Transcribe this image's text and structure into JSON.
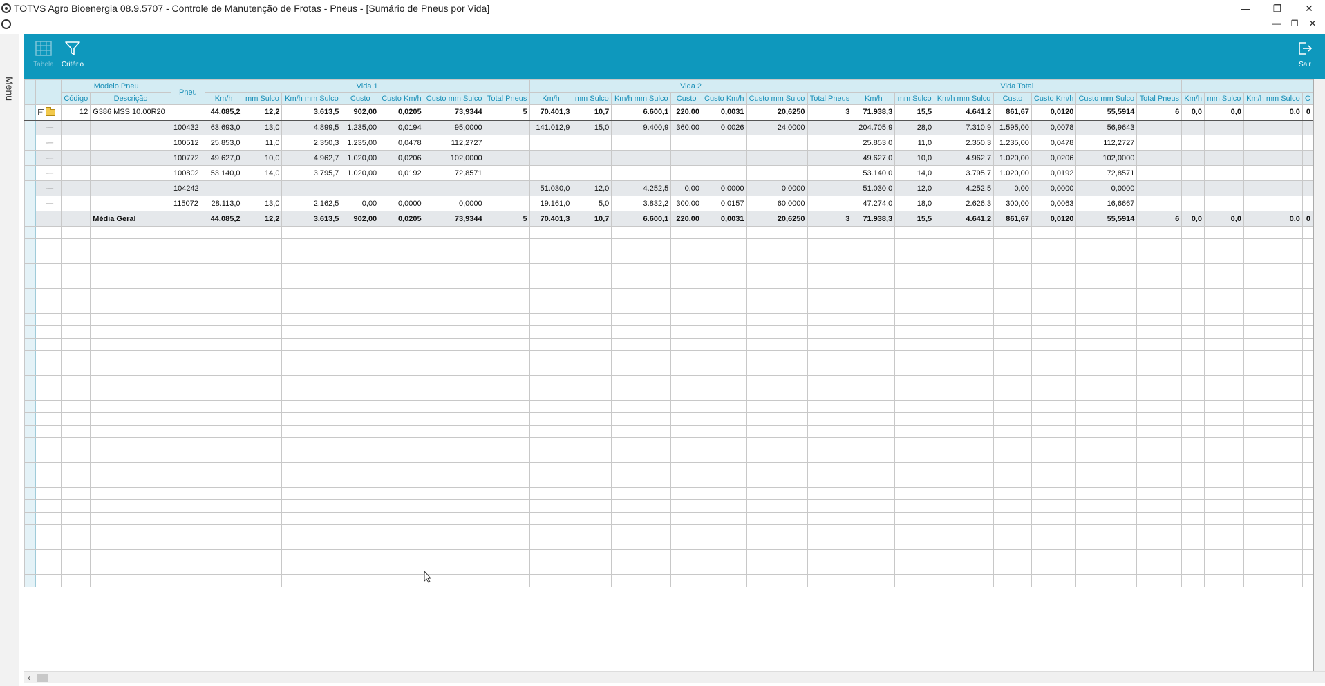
{
  "window": {
    "title": "TOTVS Agro Bioenergia 08.9.5707 - Controle de Manutenção de Frotas - Pneus - [Sumário de Pneus por Vida]",
    "minimize": "—",
    "maximize": "❐",
    "close": "✕"
  },
  "mdi": {
    "minimize": "—",
    "restore": "❐",
    "close": "✕"
  },
  "side_menu": {
    "label": "Menu"
  },
  "toolbar": {
    "tabela_label": "Tabela",
    "criterio_label": "Critério",
    "sair_label": "Sair"
  },
  "grid": {
    "group_headers": {
      "modelo": "Modelo Pneu",
      "vida1": "Vida 1",
      "vida2": "Vida 2",
      "vida_total": "Vida Total"
    },
    "columns": {
      "codigo": "Código",
      "descricao": "Descrição",
      "pneu": "Pneu",
      "kmh": "Km/h",
      "mm_sulco": "mm Sulco",
      "kmh_mm_sulco": "Km/h mm Sulco",
      "custo": "Custo",
      "custo_kmh": "Custo Km/h",
      "custo_mm_sulco": "Custo mm Sulco",
      "total_pneus": "Total Pneus",
      "extra_kmh": "Km/h",
      "extra_mm_sulco": "mm Sulco",
      "extra_kmh_mm_sulco": "Km/h mm Sulco",
      "extra_c": "C"
    },
    "parent": {
      "codigo": "12",
      "descricao": "G386 MSS 10.00R20",
      "pneu": "",
      "v1": [
        "44.085,2",
        "12,2",
        "3.613,5",
        "902,00",
        "0,0205",
        "73,9344",
        "5"
      ],
      "v2": [
        "70.401,3",
        "10,7",
        "6.600,1",
        "220,00",
        "0,0031",
        "20,6250",
        "3"
      ],
      "vt": [
        "71.938,3",
        "15,5",
        "4.641,2",
        "861,67",
        "0,0120",
        "55,5914",
        "6"
      ],
      "extra": [
        "0,0",
        "0,0",
        "0,0",
        "0"
      ]
    },
    "rows": [
      {
        "pneu": "100432",
        "v1": [
          "63.693,0",
          "13,0",
          "4.899,5",
          "1.235,00",
          "0,0194",
          "95,0000",
          ""
        ],
        "v2": [
          "141.012,9",
          "15,0",
          "9.400,9",
          "360,00",
          "0,0026",
          "24,0000",
          ""
        ],
        "vt": [
          "204.705,9",
          "28,0",
          "7.310,9",
          "1.595,00",
          "0,0078",
          "56,9643",
          ""
        ]
      },
      {
        "pneu": "100512",
        "v1": [
          "25.853,0",
          "11,0",
          "2.350,3",
          "1.235,00",
          "0,0478",
          "112,2727",
          ""
        ],
        "v2": [
          "",
          "",
          "",
          "",
          "",
          "",
          ""
        ],
        "vt": [
          "25.853,0",
          "11,0",
          "2.350,3",
          "1.235,00",
          "0,0478",
          "112,2727",
          ""
        ]
      },
      {
        "pneu": "100772",
        "v1": [
          "49.627,0",
          "10,0",
          "4.962,7",
          "1.020,00",
          "0,0206",
          "102,0000",
          ""
        ],
        "v2": [
          "",
          "",
          "",
          "",
          "",
          "",
          ""
        ],
        "vt": [
          "49.627,0",
          "10,0",
          "4.962,7",
          "1.020,00",
          "0,0206",
          "102,0000",
          ""
        ]
      },
      {
        "pneu": "100802",
        "v1": [
          "53.140,0",
          "14,0",
          "3.795,7",
          "1.020,00",
          "0,0192",
          "72,8571",
          ""
        ],
        "v2": [
          "",
          "",
          "",
          "",
          "",
          "",
          ""
        ],
        "vt": [
          "53.140,0",
          "14,0",
          "3.795,7",
          "1.020,00",
          "0,0192",
          "72,8571",
          ""
        ]
      },
      {
        "pneu": "104242",
        "v1": [
          "",
          "",
          "",
          "",
          "",
          "",
          ""
        ],
        "v2": [
          "51.030,0",
          "12,0",
          "4.252,5",
          "0,00",
          "0,0000",
          "0,0000",
          ""
        ],
        "vt": [
          "51.030,0",
          "12,0",
          "4.252,5",
          "0,00",
          "0,0000",
          "0,0000",
          ""
        ]
      },
      {
        "pneu": "115072",
        "v1": [
          "28.113,0",
          "13,0",
          "2.162,5",
          "0,00",
          "0,0000",
          "0,0000",
          ""
        ],
        "v2": [
          "19.161,0",
          "5,0",
          "3.832,2",
          "300,00",
          "0,0157",
          "60,0000",
          ""
        ],
        "vt": [
          "47.274,0",
          "18,0",
          "2.626,3",
          "300,00",
          "0,0063",
          "16,6667",
          ""
        ]
      }
    ],
    "total": {
      "label": "Média Geral",
      "v1": [
        "44.085,2",
        "12,2",
        "3.613,5",
        "902,00",
        "0,0205",
        "73,9344",
        "5"
      ],
      "v2": [
        "70.401,3",
        "10,7",
        "6.600,1",
        "220,00",
        "0,0031",
        "20,6250",
        "3"
      ],
      "vt": [
        "71.938,3",
        "15,5",
        "4.641,2",
        "861,67",
        "0,0120",
        "55,5914",
        "6"
      ],
      "extra": [
        "0,0",
        "0,0",
        "0,0",
        "0"
      ]
    },
    "empty_rows": 29
  }
}
